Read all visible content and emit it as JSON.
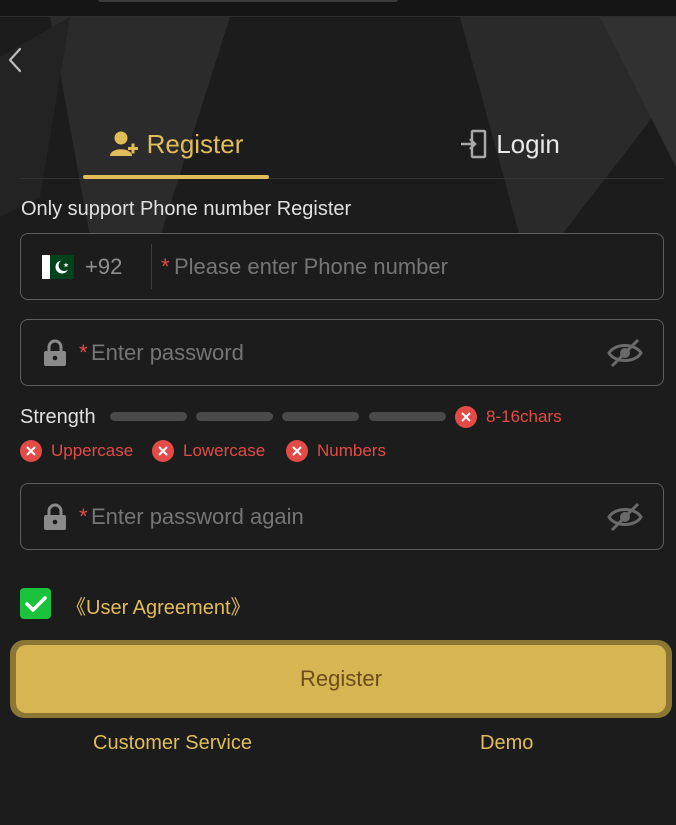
{
  "nav": {
    "back_icon": "chevron-left-icon"
  },
  "tabs": [
    {
      "label": "Register",
      "icon": "user-plus-icon",
      "active": true
    },
    {
      "label": "Login",
      "icon": "login-door-icon",
      "active": false
    }
  ],
  "hint": "Only support Phone number Register",
  "phone": {
    "flag": "pakistan-flag-icon",
    "country_code": "+92",
    "required_mark": "*",
    "placeholder": "Please enter Phone number"
  },
  "password": {
    "required_mark": "*",
    "placeholder": "Enter password",
    "icon": "lock-icon",
    "toggle_icon": "eye-hidden-icon"
  },
  "strength": {
    "label": "Strength",
    "level": 0,
    "segments": 4,
    "requirements": [
      "8-16chars",
      "Uppercase",
      "Lowercase",
      "Numbers"
    ]
  },
  "confirm_password": {
    "required_mark": "*",
    "placeholder": "Enter password again",
    "icon": "lock-icon",
    "toggle_icon": "eye-hidden-icon"
  },
  "agreement": {
    "checked": true,
    "label": "《User Agreement》"
  },
  "register_button": "Register",
  "footer": {
    "customer_service": "Customer Service",
    "demo": "Demo"
  },
  "colors": {
    "background": "#1c1c1c",
    "accent": "#e1bd59",
    "error": "#e34b46",
    "check": "#1ac33b",
    "button": "#d7b552"
  }
}
